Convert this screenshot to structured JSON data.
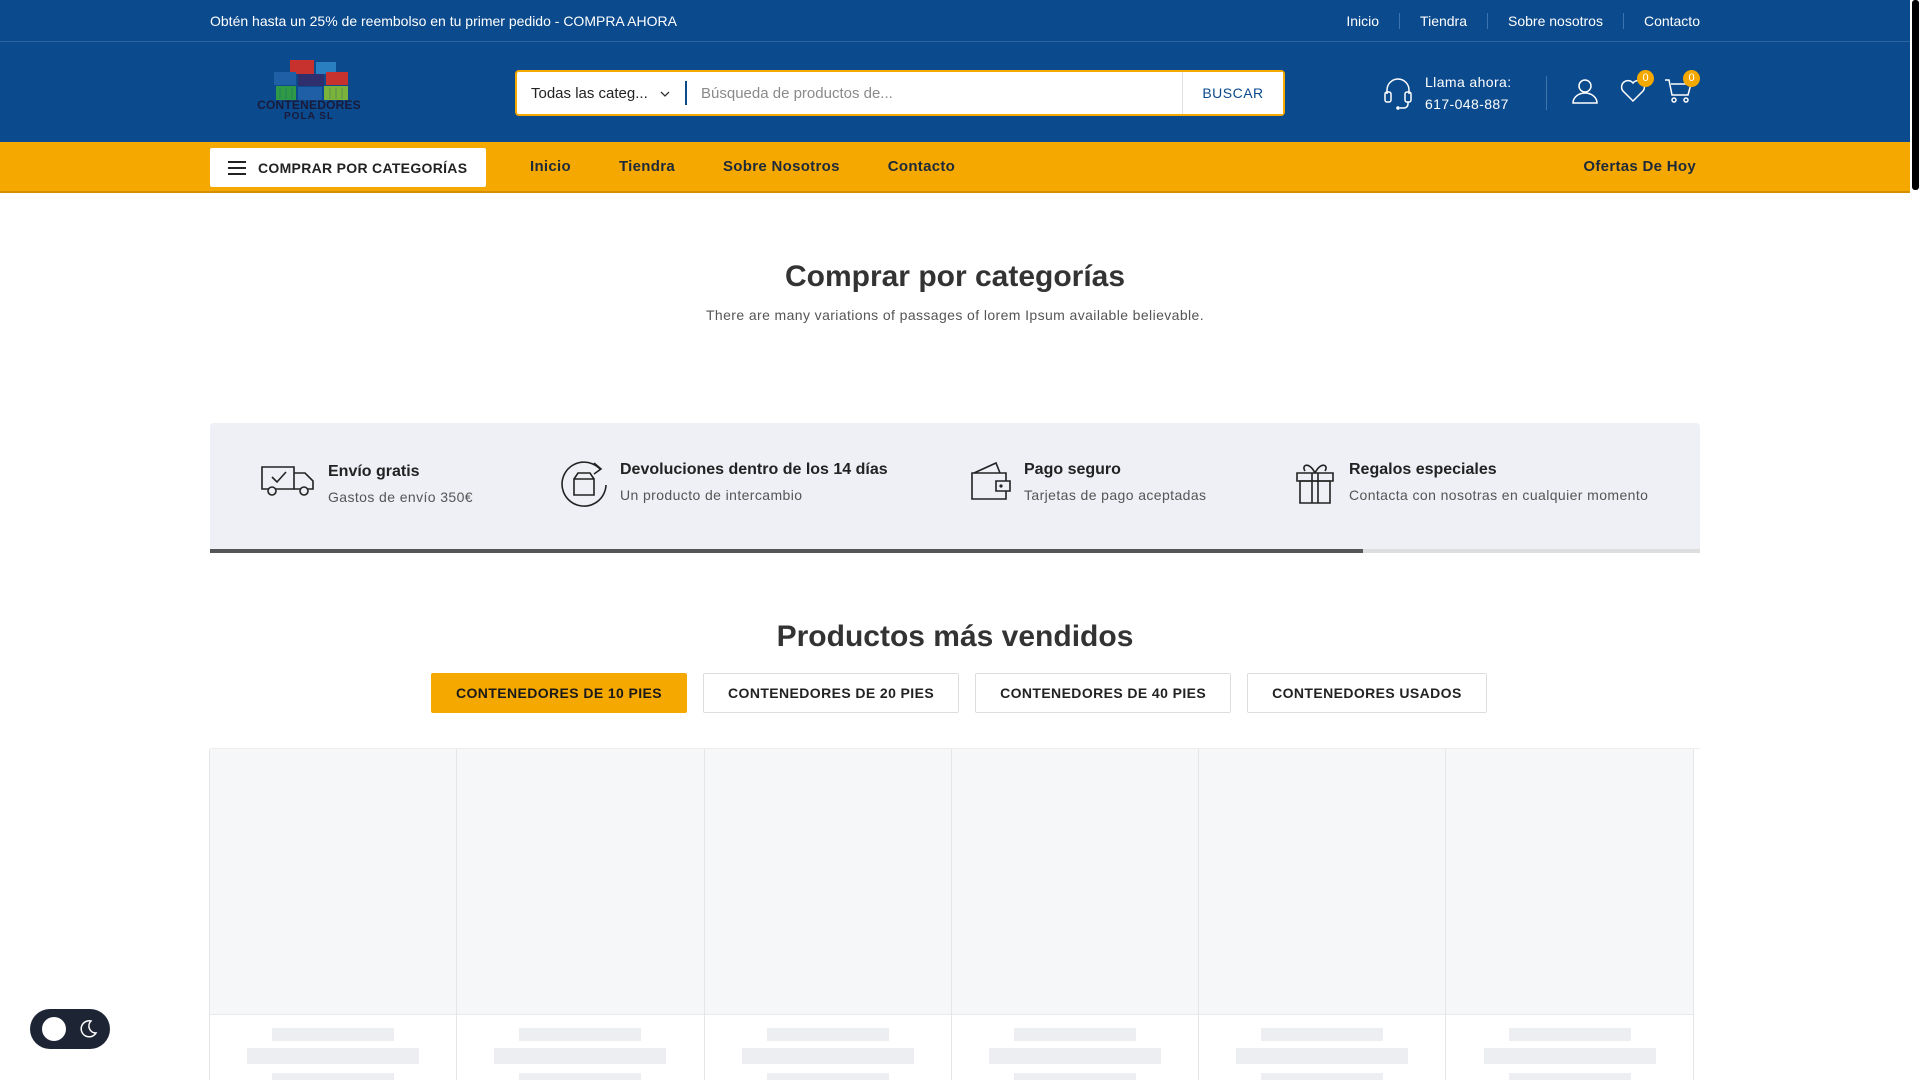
{
  "topbar": {
    "promo": "Obtén hasta un 25% de reembolso en tu primer pedido - COMPRA AHORA",
    "links": [
      "Inicio",
      "Tiendra",
      "Sobre nosotros",
      "Contacto"
    ]
  },
  "header": {
    "logo_text_line1": "CONTENEDORES",
    "logo_text_line2": "POLA SL",
    "search_category": "Todas las categ...",
    "search_placeholder": "Búsqueda de productos de...",
    "search_button": "BUSCAR",
    "call_label": "Llama ahora:",
    "call_number": "617-048-887",
    "wishlist_count": "0",
    "cart_count": "0"
  },
  "nav": {
    "categories_button": "COMPRAR POR CATEGORÍAS",
    "items": [
      "Inicio",
      "Tiendra",
      "Sobre Nosotros",
      "Contacto"
    ],
    "deals": "Ofertas De Hoy"
  },
  "categories_section": {
    "title": "Comprar por categorías",
    "subtitle": "There are many variations of passages of lorem Ipsum available believable."
  },
  "features": [
    {
      "title": "Envío gratis",
      "desc": "Gastos de envío 350€",
      "icon": "truck-icon"
    },
    {
      "title": "Devoluciones dentro de los 14 días",
      "desc": "Un producto de intercambio",
      "icon": "return-box-icon"
    },
    {
      "title": "Pago seguro",
      "desc": "Tarjetas de pago aceptadas",
      "icon": "wallet-icon"
    },
    {
      "title": "Regalos especiales",
      "desc": "Contacta con nosotras en cualquier momento",
      "icon": "gift-icon"
    }
  ],
  "bestsellers": {
    "title": "Productos más vendidos",
    "tabs": [
      "CONTENEDORES DE 10 PIES",
      "CONTENEDORES DE 20 PIES",
      "CONTENEDORES DE 40 PIES",
      "CONTENEDORES USADOS"
    ],
    "active_tab": 0
  },
  "colors": {
    "primary": "#0b4a8c",
    "accent": "#f5a800",
    "panel": "#eef0f6"
  }
}
